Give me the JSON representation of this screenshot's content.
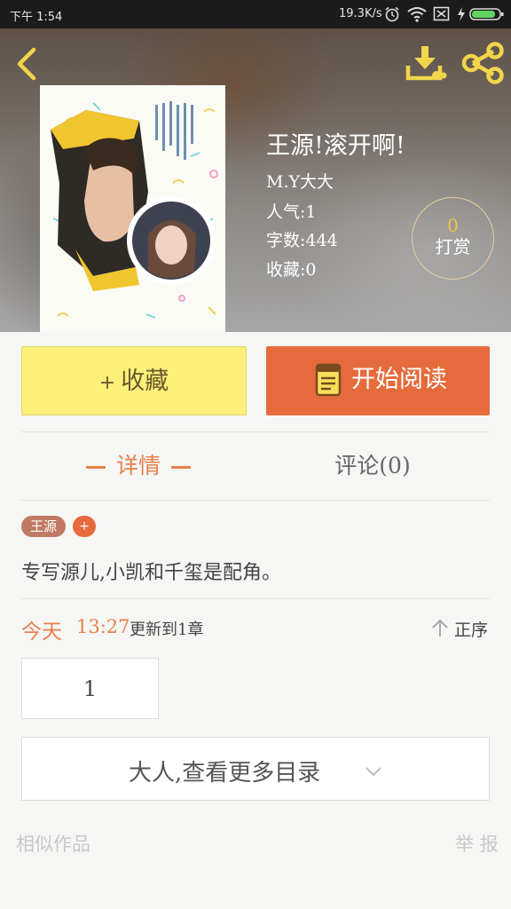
{
  "status_bar": {
    "time": "下午 1:54",
    "net_speed": "19.3K/s"
  },
  "book": {
    "title": "王源!滚开啊!",
    "author": "M.Y大大",
    "popularity": "人气:1",
    "word_count": "字数:444",
    "favorites": "收藏:0",
    "reward_count": "0",
    "reward_label": "打赏"
  },
  "actions": {
    "favorite_plus": "+",
    "favorite_label": "收藏",
    "read_label": "开始阅读"
  },
  "tabs": {
    "details": "详情",
    "comments": "评论(0)"
  },
  "tags": [
    {
      "label": "王源"
    }
  ],
  "tag_add": "+",
  "intro": "专写源儿,小凯和千玺是配角。",
  "update": {
    "day": "今天",
    "time": "13:27",
    "text": "更新到1章",
    "sort_label": "正序"
  },
  "chapters": [
    "1"
  ],
  "more_catalog": "大人,查看更多目录",
  "footer": {
    "similar": "相似作品",
    "report": "举 报"
  },
  "colors": {
    "accent_orange": "#e66b3c",
    "favorite_yellow": "#fcf07a",
    "icon_yellow": "#f2d64a"
  },
  "icons": [
    "back-arrow-icon",
    "download-icon",
    "share-icon",
    "book-icon",
    "sort-arrow-icon",
    "chevron-down-icon",
    "alarm-icon",
    "wifi-icon",
    "sim-icon",
    "charging-icon",
    "battery-icon"
  ]
}
